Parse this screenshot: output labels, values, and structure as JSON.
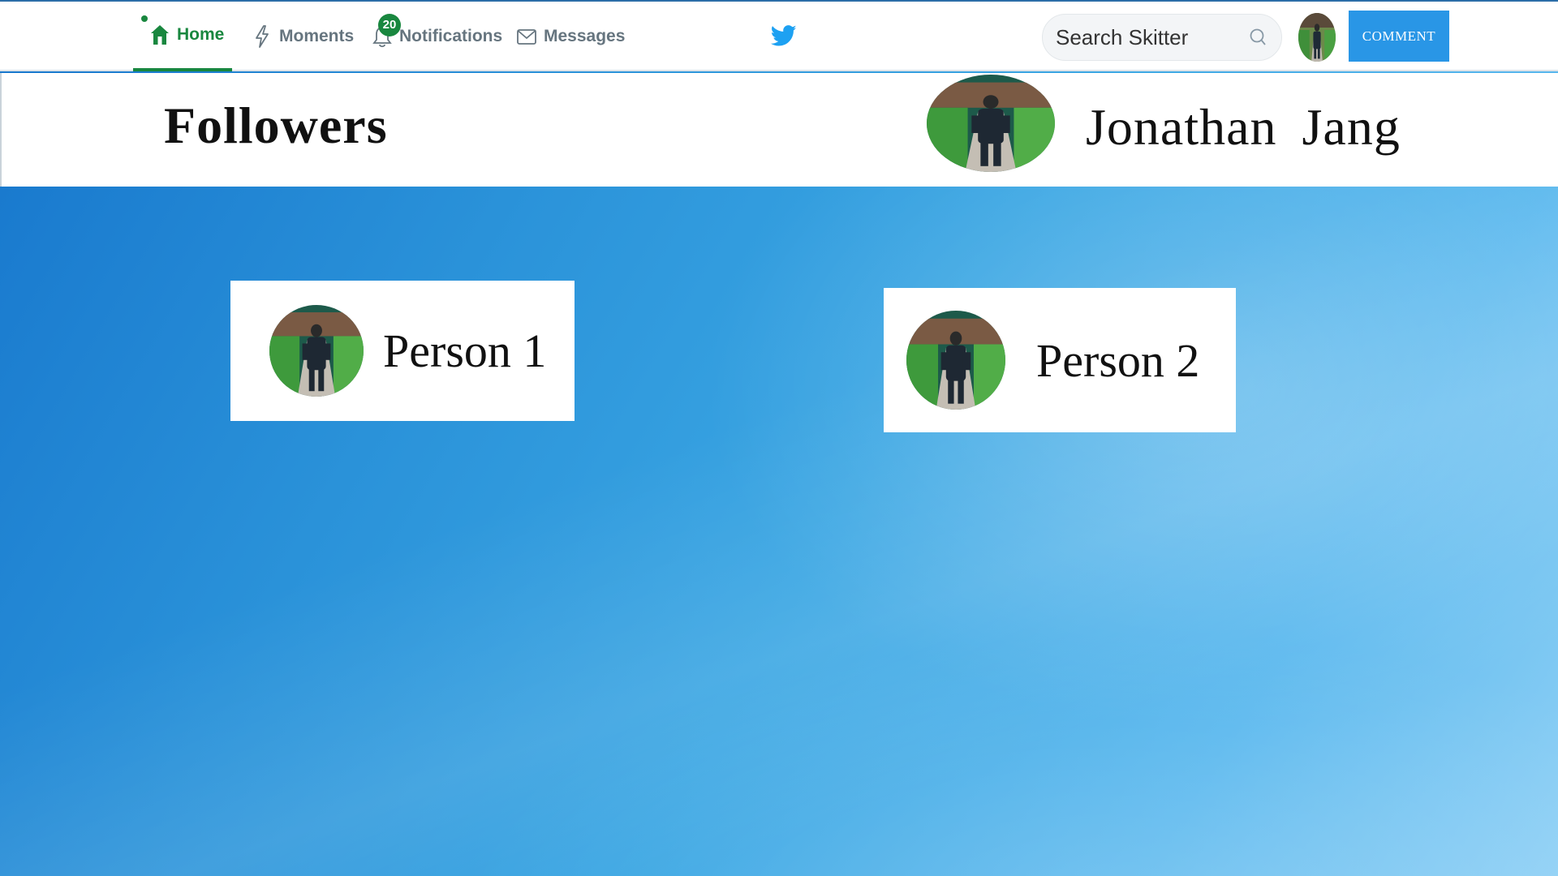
{
  "nav": {
    "items": [
      {
        "label": "Home",
        "icon": "home-icon",
        "active": true
      },
      {
        "label": "Moments",
        "icon": "lightning-icon",
        "active": false
      },
      {
        "label": "Notifications",
        "icon": "bell-icon",
        "active": false,
        "badge": "20"
      },
      {
        "label": "Messages",
        "icon": "envelope-icon",
        "active": false
      }
    ],
    "logo_icon": "bird-icon"
  },
  "search": {
    "placeholder": "Search Skitter",
    "icon": "search-icon"
  },
  "comment_button": {
    "label": "COMMENT"
  },
  "header": {
    "title": "Followers",
    "profile_name": "Jonathan  Jang"
  },
  "followers": [
    {
      "name": "Person 1"
    },
    {
      "name": "Person 2"
    }
  ],
  "colors": {
    "accent_green": "#19873f",
    "button_blue": "#2996e6",
    "bird_blue": "#1da1f2",
    "background_blue": "#2a92d9"
  }
}
